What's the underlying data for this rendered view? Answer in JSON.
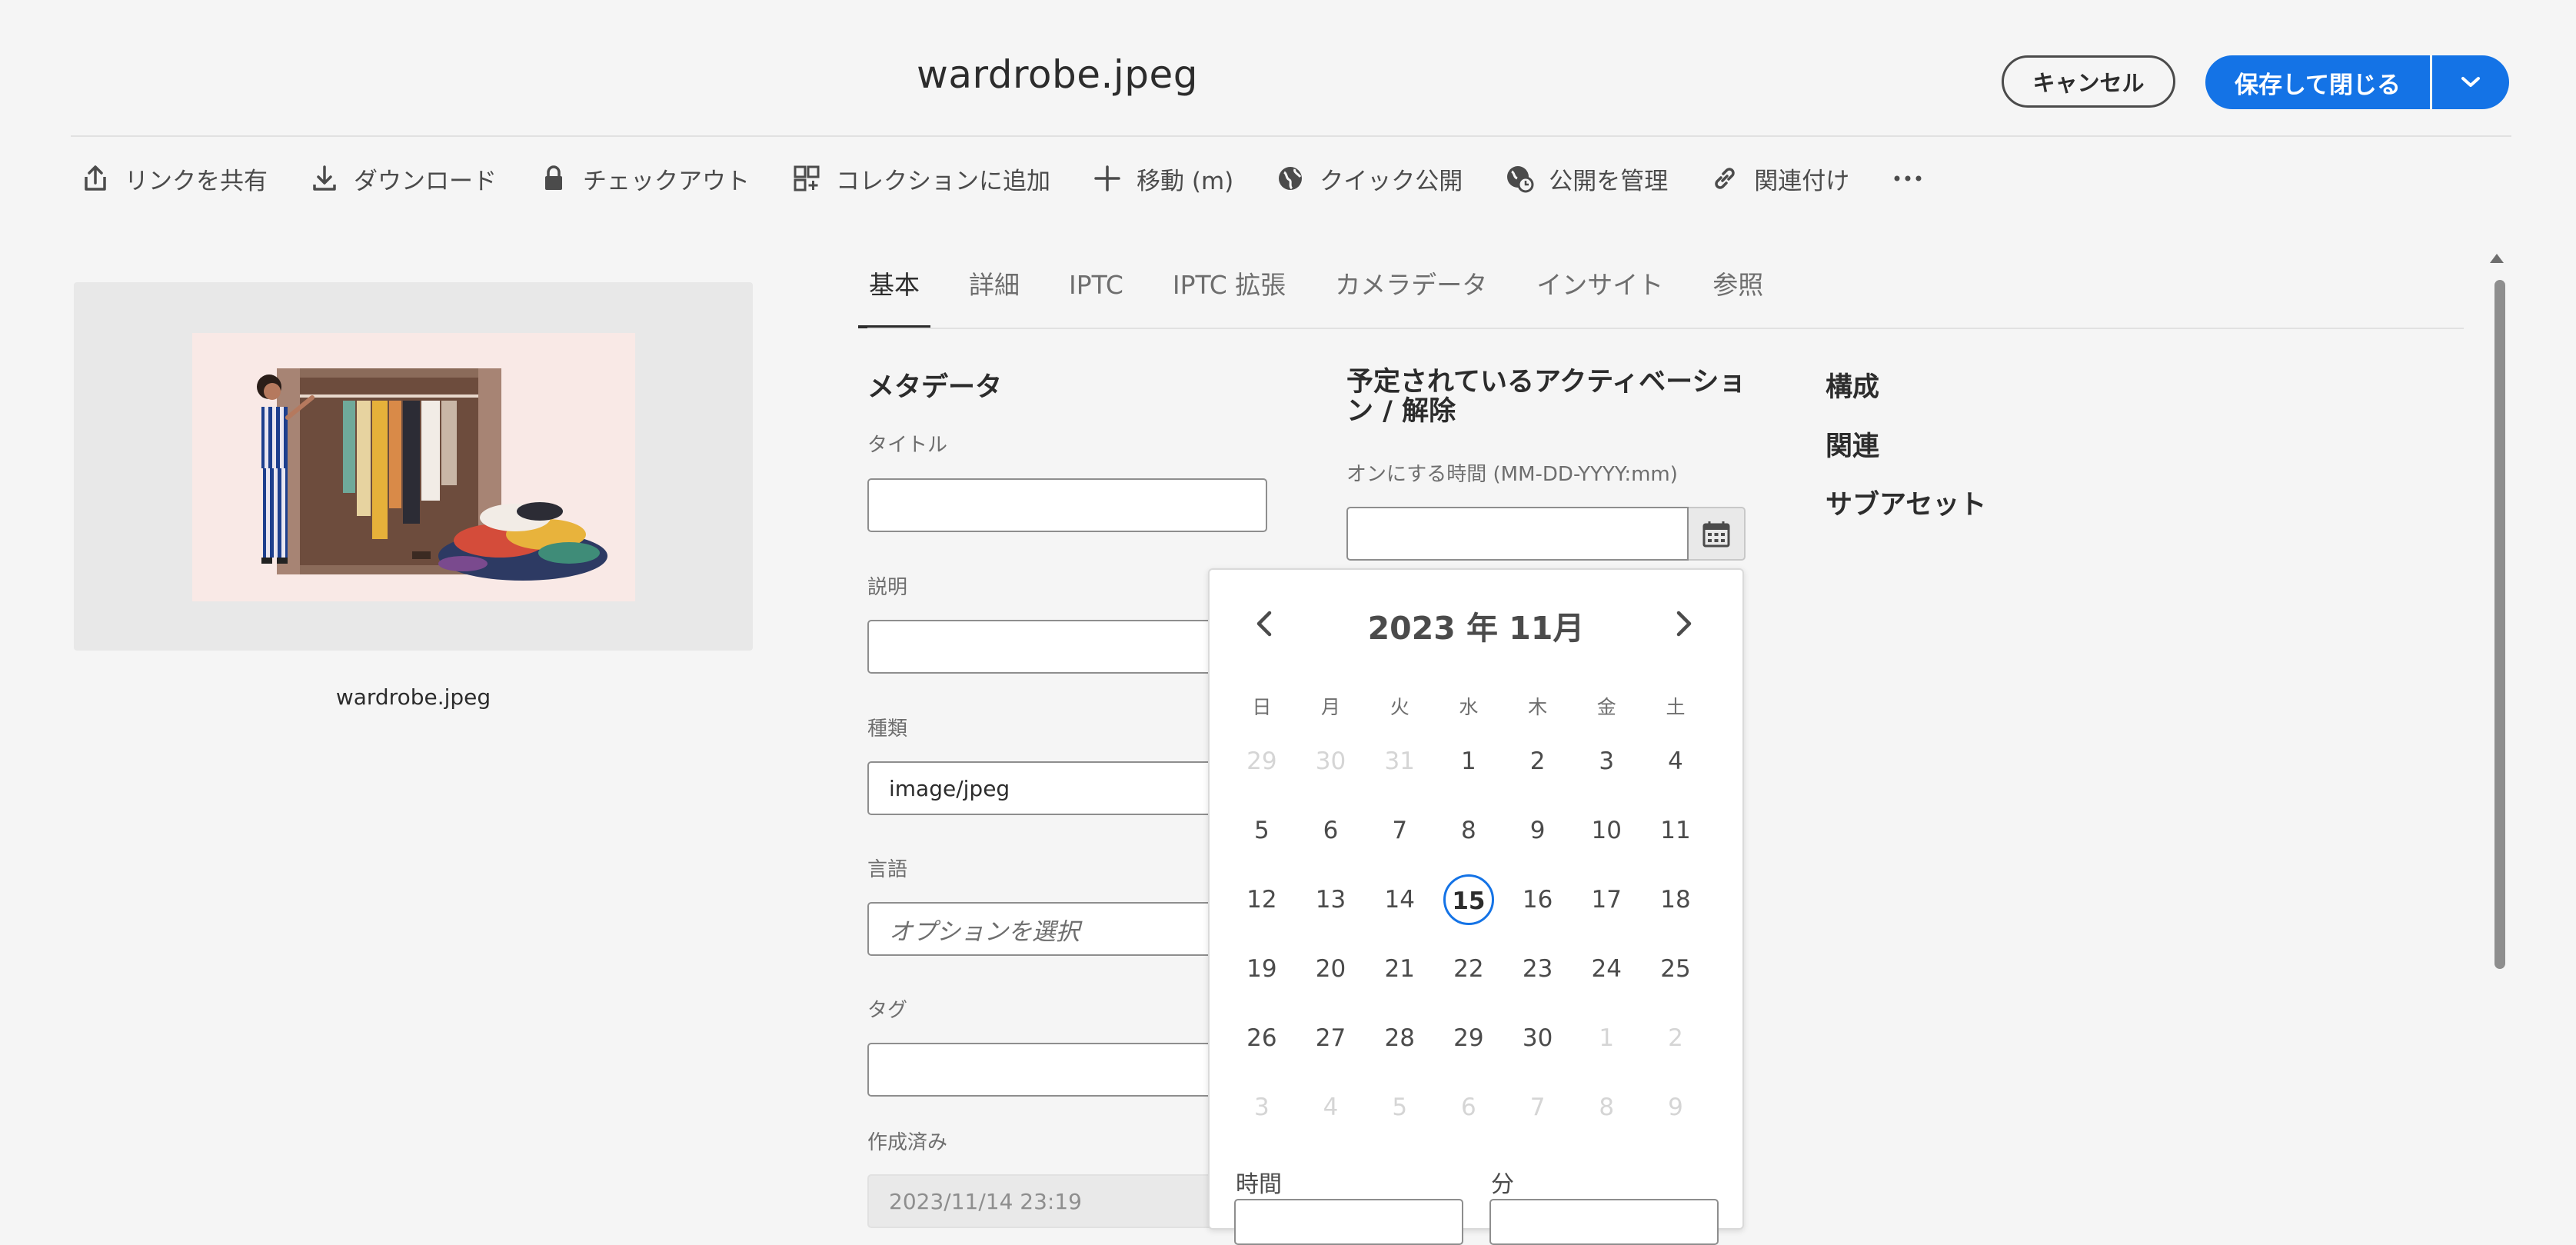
{
  "header": {
    "title": "wardrobe.jpeg",
    "cancel_label": "キャンセル",
    "save_label": "保存して閉じる"
  },
  "toolbar": {
    "items": [
      {
        "label": "リンクを共有",
        "icon": "share-icon"
      },
      {
        "label": "ダウンロード",
        "icon": "download-icon"
      },
      {
        "label": "チェックアウト",
        "icon": "lock-icon"
      },
      {
        "label": "コレクションに追加",
        "icon": "add-to-collection-icon"
      },
      {
        "label": "移動 (m)",
        "icon": "move-icon"
      },
      {
        "label": "クイック公開",
        "icon": "globe-icon"
      },
      {
        "label": "公開を管理",
        "icon": "globe-clock-icon"
      },
      {
        "label": "関連付け",
        "icon": "link-icon"
      }
    ],
    "more_icon": "more-icon"
  },
  "preview": {
    "filename": "wardrobe.jpeg"
  },
  "tabs": [
    "基本",
    "詳細",
    "IPTC",
    "IPTC 拡張",
    "カメラデータ",
    "インサイト",
    "参照"
  ],
  "metadata": {
    "heading": "メタデータ",
    "title_label": "タイトル",
    "title_value": "",
    "description_label": "説明",
    "description_value": "",
    "type_label": "種類",
    "type_value": "image/jpeg",
    "language_label": "言語",
    "language_placeholder": "オプションを選択",
    "tags_label": "タグ",
    "tags_value": "",
    "created_label": "作成済み",
    "created_value": "2023/11/14 23:19"
  },
  "activation": {
    "heading": "予定されているアクティベーション / 解除",
    "on_time_label": "オンにする時間 (MM-DD-YYYY:mm)",
    "on_time_value": ""
  },
  "side_links": [
    "構成",
    "関連",
    "サブアセット"
  ],
  "calendar": {
    "title": "2023 年 11月",
    "weekdays": [
      "日",
      "月",
      "火",
      "水",
      "木",
      "金",
      "土"
    ],
    "weeks": [
      [
        {
          "d": "29",
          "out": true
        },
        {
          "d": "30",
          "out": true
        },
        {
          "d": "31",
          "out": true
        },
        {
          "d": "1"
        },
        {
          "d": "2"
        },
        {
          "d": "3"
        },
        {
          "d": "4"
        }
      ],
      [
        {
          "d": "5"
        },
        {
          "d": "6"
        },
        {
          "d": "7"
        },
        {
          "d": "8"
        },
        {
          "d": "9"
        },
        {
          "d": "10"
        },
        {
          "d": "11"
        }
      ],
      [
        {
          "d": "12"
        },
        {
          "d": "13"
        },
        {
          "d": "14"
        },
        {
          "d": "15",
          "today": true
        },
        {
          "d": "16"
        },
        {
          "d": "17"
        },
        {
          "d": "18"
        }
      ],
      [
        {
          "d": "19"
        },
        {
          "d": "20"
        },
        {
          "d": "21"
        },
        {
          "d": "22"
        },
        {
          "d": "23"
        },
        {
          "d": "24"
        },
        {
          "d": "25"
        }
      ],
      [
        {
          "d": "26"
        },
        {
          "d": "27"
        },
        {
          "d": "28"
        },
        {
          "d": "29"
        },
        {
          "d": "30"
        },
        {
          "d": "1",
          "out": true
        },
        {
          "d": "2",
          "out": true
        }
      ],
      [
        {
          "d": "3",
          "out": true
        },
        {
          "d": "4",
          "out": true
        },
        {
          "d": "5",
          "out": true
        },
        {
          "d": "6",
          "out": true
        },
        {
          "d": "7",
          "out": true
        },
        {
          "d": "8",
          "out": true
        },
        {
          "d": "9",
          "out": true
        }
      ]
    ],
    "hour_label": "時間",
    "minute_label": "分"
  },
  "colors": {
    "accent": "#1473e6",
    "background": "#f5f5f5",
    "text": "#2c2c2c"
  }
}
